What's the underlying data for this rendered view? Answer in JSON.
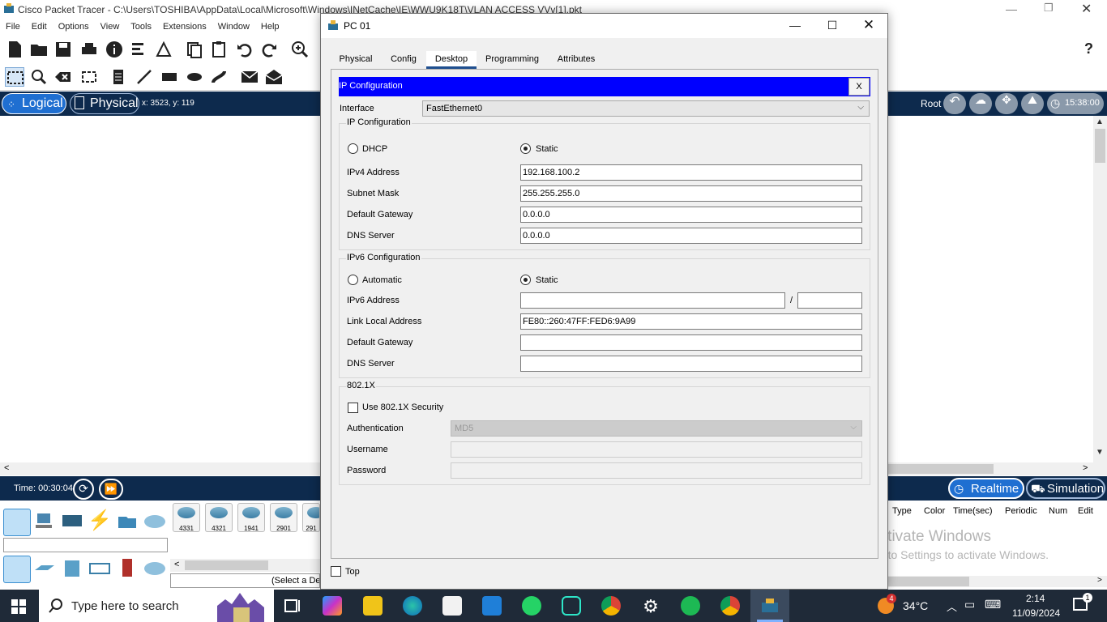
{
  "app": {
    "title": "Cisco Packet Tracer - C:\\Users\\TOSHIBA\\AppData\\Local\\Microsoft\\Windows\\INetCache\\IE\\WWU9K18T\\VLAN ACCESS VVv[1].pkt",
    "menu": [
      "File",
      "Edit",
      "Options",
      "View",
      "Tools",
      "Extensions",
      "Window",
      "Help"
    ]
  },
  "nav": {
    "logical": "Logical",
    "physical": "Physical",
    "coords": "x: 3523, y: 119",
    "root": "Root",
    "clock": "15:38:00"
  },
  "timebar": {
    "time": "Time: 00:30:04",
    "realtime": "Realtime",
    "simulation": "Simulation"
  },
  "devices": {
    "models": [
      "4331",
      "4321",
      "1941",
      "2901",
      "291"
    ],
    "select_hint": "(Select a De"
  },
  "event_table": {
    "headers": [
      "Type",
      "Color",
      "Time(sec)",
      "Periodic",
      "Num",
      "Edit"
    ]
  },
  "watermark": {
    "line1": "Activate Windows",
    "line2": "Go to Settings to activate Windows."
  },
  "pc": {
    "window_title": "PC 01",
    "tabs": [
      "Physical",
      "Config",
      "Desktop",
      "Programming",
      "Attributes"
    ],
    "active_tab": "Desktop",
    "ip_config_title": "IP Configuration",
    "close_label": "X",
    "interface_label": "Interface",
    "interface_value": "FastEthernet0",
    "ipv4": {
      "group": "IP Configuration",
      "dhcp": "DHCP",
      "static": "Static",
      "mode": "Static",
      "address_label": "IPv4 Address",
      "address": "192.168.100.2",
      "mask_label": "Subnet Mask",
      "mask": "255.255.255.0",
      "gateway_label": "Default Gateway",
      "gateway": "0.0.0.0",
      "dns_label": "DNS Server",
      "dns": "0.0.0.0"
    },
    "ipv6": {
      "group": "IPv6 Configuration",
      "automatic": "Automatic",
      "static": "Static",
      "mode": "Static",
      "address_label": "IPv6 Address",
      "address": "",
      "prefix_sep": "/",
      "prefix": "",
      "link_local_label": "Link Local Address",
      "link_local": "FE80::260:47FF:FED6:9A99",
      "gateway_label": "Default Gateway",
      "gateway": "",
      "dns_label": "DNS Server",
      "dns": ""
    },
    "dot1x": {
      "group": "802.1X",
      "use_label": "Use 802.1X Security",
      "enabled": false,
      "auth_label": "Authentication",
      "auth_value": "MD5",
      "username_label": "Username",
      "username": "",
      "password_label": "Password",
      "password": ""
    },
    "top_label": "Top"
  },
  "taskbar": {
    "search_placeholder": "Type here to search",
    "weather": "34°C",
    "weather_badge": "4",
    "time": "2:14",
    "date": "11/09/2024",
    "notif_count": "1"
  }
}
